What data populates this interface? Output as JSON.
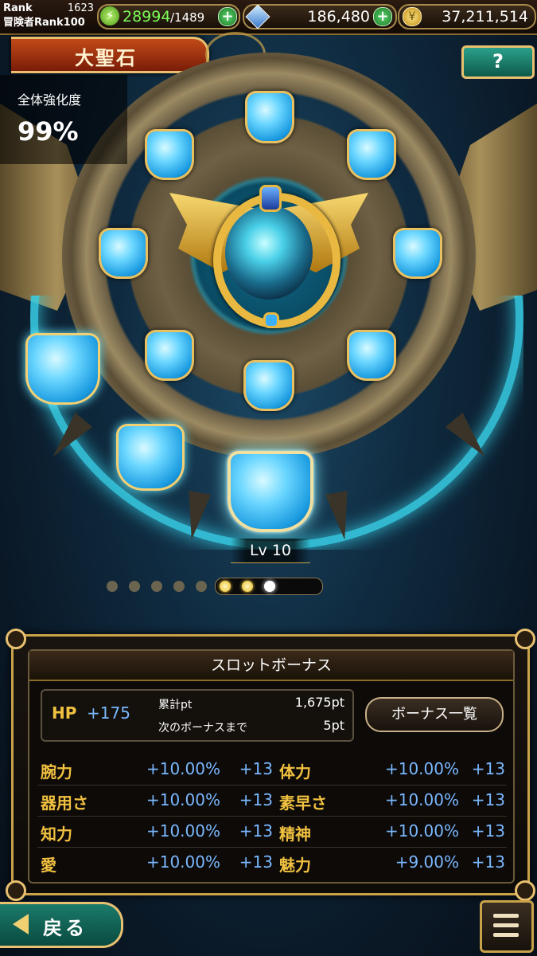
{
  "header": {
    "rank_label": "Rank",
    "rank_value": "1623",
    "adventurer_rank": "冒険者Rank100",
    "stamina_current": "28994",
    "stamina_max": "/1489",
    "gems": "186,480",
    "gold": "37,211,514"
  },
  "title": "大聖石",
  "help_label": "?",
  "overall": {
    "label": "全体強化度",
    "value": "99%"
  },
  "slot": {
    "level": "Lv 10"
  },
  "pager": {
    "total": 9,
    "current_index": 6,
    "filled": [
      5,
      6
    ]
  },
  "bonus": {
    "heading": "スロットボーナス",
    "hp_label": "HP",
    "hp_value": "+175",
    "total_pt_label": "累計pt",
    "total_pt_value": "1,675pt",
    "next_label": "次のボーナスまで",
    "next_value": "5pt",
    "list_button": "ボーナス一覧",
    "stats": [
      {
        "name": "腕力",
        "pct": "+10.00%",
        "flat": "+13"
      },
      {
        "name": "体力",
        "pct": "+10.00%",
        "flat": "+13"
      },
      {
        "name": "器用さ",
        "pct": "+10.00%",
        "flat": "+13"
      },
      {
        "name": "素早さ",
        "pct": "+10.00%",
        "flat": "+13"
      },
      {
        "name": "知力",
        "pct": "+10.00%",
        "flat": "+13"
      },
      {
        "name": "精神",
        "pct": "+10.00%",
        "flat": "+13"
      },
      {
        "name": "愛",
        "pct": "+10.00%",
        "flat": "+13"
      },
      {
        "name": "魅力",
        "pct": "+9.00%",
        "flat": "+13"
      }
    ]
  },
  "footer": {
    "back_label": "戻る"
  },
  "icons": {
    "stamina": "lightning-icon",
    "gem": "diamond-icon",
    "gold": "coin-icon",
    "menu": "hamburger-icon"
  },
  "colors": {
    "accent_gold": "#e8c070",
    "stat_name": "#f0c040",
    "stat_value": "#7ab8ff",
    "stamina_text": "#7dff5a"
  }
}
